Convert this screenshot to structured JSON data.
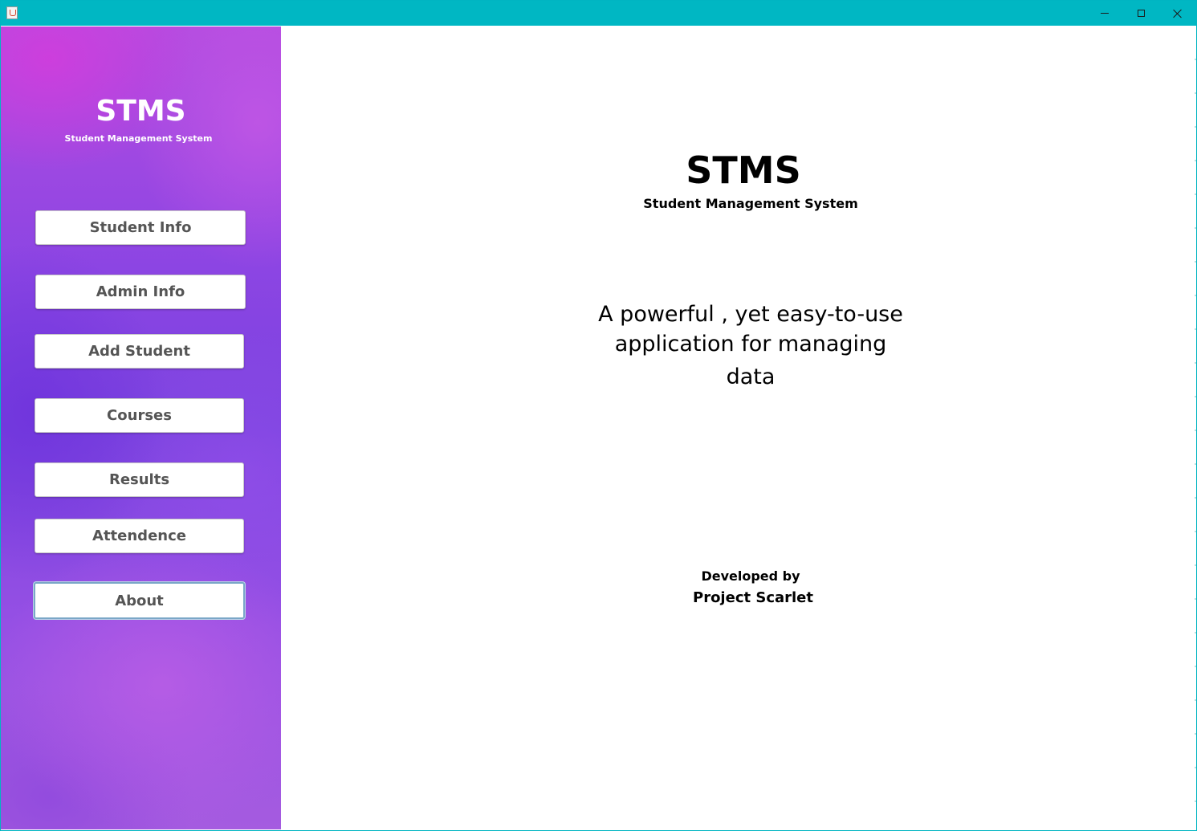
{
  "window": {
    "controls": {
      "minimize_icon": "minimize-icon",
      "maximize_icon": "maximize-icon",
      "close_icon": "close-icon"
    },
    "titlebar_color": "#00b7c3"
  },
  "sidebar": {
    "title": "STMS",
    "subtitle": "Student Management System",
    "items": [
      {
        "label": "Student Info"
      },
      {
        "label": "Admin Info"
      },
      {
        "label": "Add Student"
      },
      {
        "label": "Courses"
      },
      {
        "label": "Results"
      },
      {
        "label": "Attendence"
      },
      {
        "label": "About"
      }
    ],
    "background_color": "#8c45e3"
  },
  "main": {
    "title": "STMS",
    "subtitle": "Student Management System",
    "tagline_lines": [
      "A powerful , yet easy-to-use",
      "application for managing",
      "data"
    ],
    "developed_by_label": "Developed by",
    "developer": "Project Scarlet"
  }
}
